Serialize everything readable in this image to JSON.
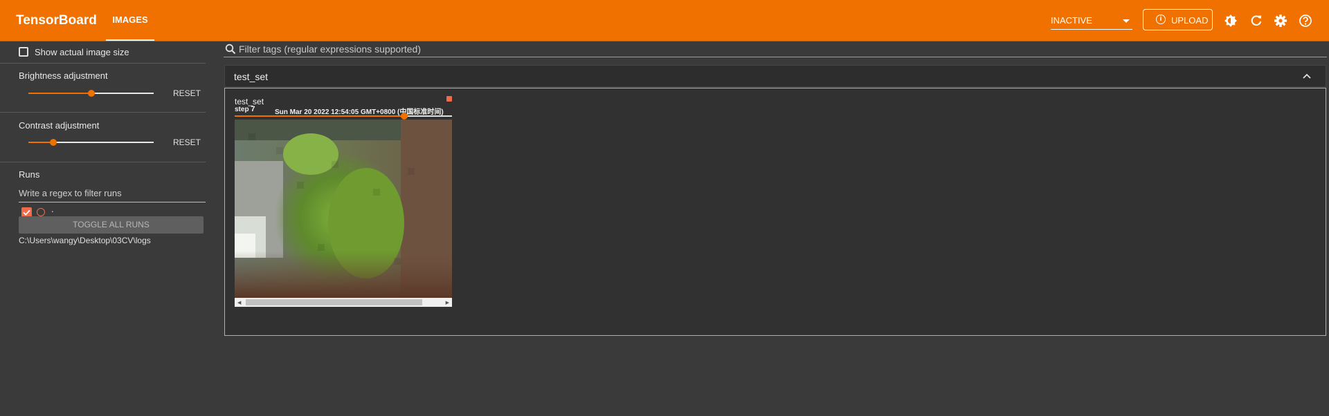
{
  "header": {
    "brand": "TensorBoard",
    "active_tab": "IMAGES",
    "reload_status": "INACTIVE",
    "upload_label": "UPLOAD",
    "accent_color": "#f07000",
    "icons": [
      "info-icon",
      "theme-contrast-icon",
      "reload-icon",
      "settings-gear-icon",
      "help-icon"
    ]
  },
  "sidebar": {
    "show_actual_size_label": "Show actual image size",
    "show_actual_size_checked": false,
    "brightness": {
      "label": "Brightness adjustment",
      "value_fraction": 0.5,
      "reset_label": "RESET"
    },
    "contrast": {
      "label": "Contrast adjustment",
      "value_fraction": 0.2,
      "reset_label": "RESET"
    },
    "runs": {
      "title": "Runs",
      "filter_placeholder": "Write a regex to filter runs",
      "items": [
        {
          "name": ".",
          "checked": true,
          "color": "#f26b48"
        }
      ],
      "toggle_all_label": "TOGGLE ALL RUNS",
      "log_dir": "C:\\Users\\wangy\\Desktop\\03CV\\logs"
    }
  },
  "main": {
    "tag_filter_placeholder": "Filter tags (regular expressions supported)",
    "group": {
      "name": "test_set",
      "expanded": true,
      "card": {
        "tag": "test_set",
        "step_label": "step",
        "step": "7",
        "timestamp": "Sun Mar 20 2022 12:54:05 GMT+0800 (中国标准时间)",
        "step_position_fraction": 0.78,
        "run_color": "#f26b48"
      }
    }
  }
}
